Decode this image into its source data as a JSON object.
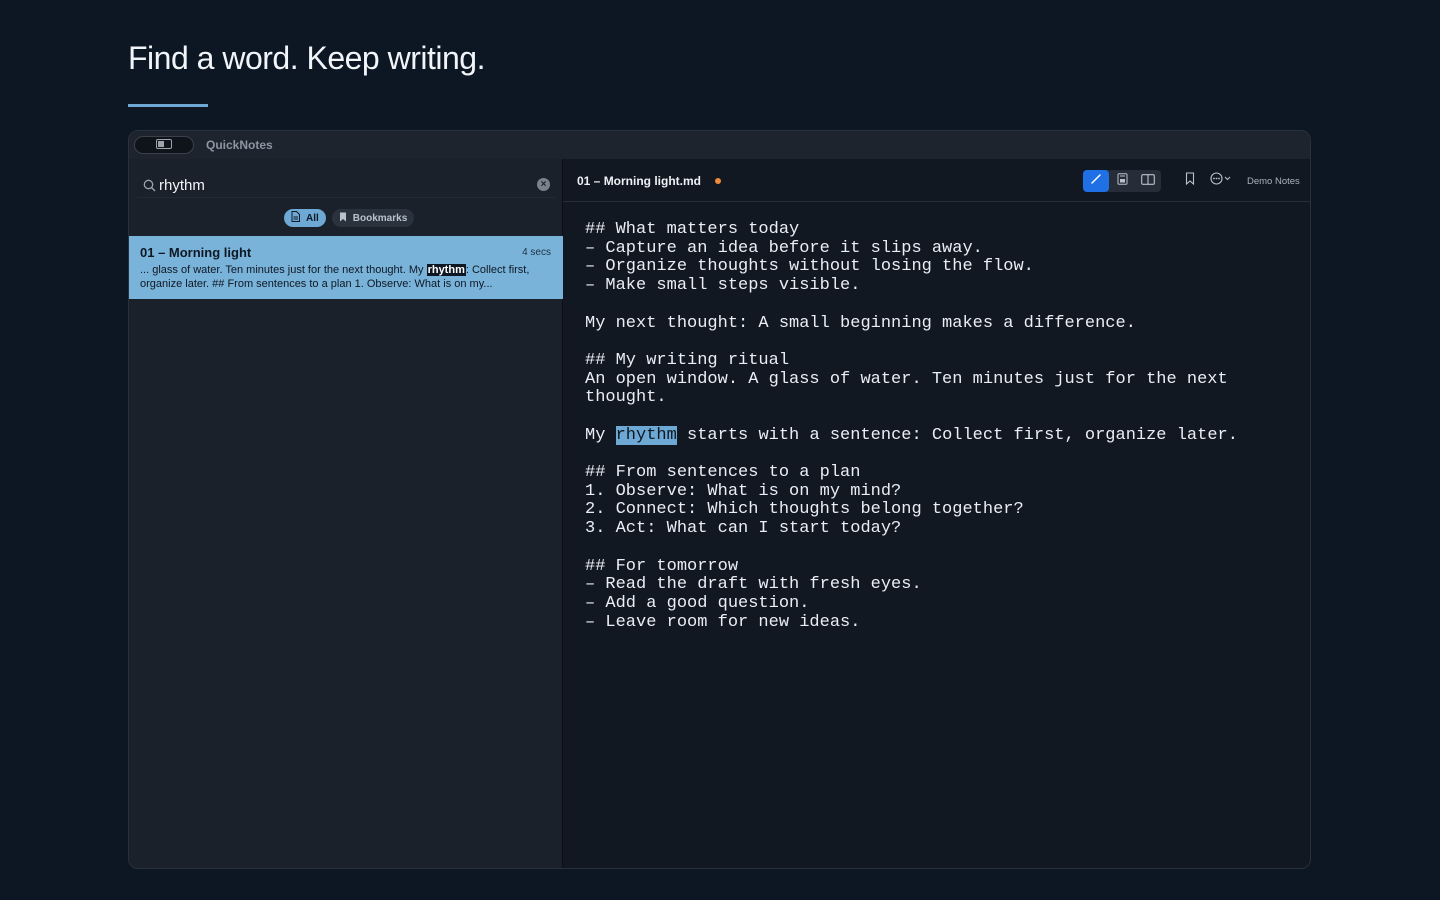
{
  "headline": "Find a word. Keep writing.",
  "app": {
    "name": "QuickNotes"
  },
  "sidebar": {
    "search": {
      "value": "rhythm",
      "placeholder": "Search"
    },
    "filters": [
      {
        "label": "All",
        "icon": "document-icon",
        "active": true
      },
      {
        "label": "Bookmarks",
        "icon": "bookmark-icon",
        "active": false
      }
    ],
    "results": [
      {
        "title": "01 – Morning light",
        "time": "4 secs",
        "snippet_before": "... glass of water. Ten minutes just for the next thought.  My ",
        "snippet_match": "rhythm",
        "snippet_after": ": Collect first, organize later.  ## From sentences to a plan 1. Observe: What is on my..."
      }
    ]
  },
  "editor": {
    "doc_title": "01 – Morning light.md",
    "unsaved": true,
    "workspace": "Demo Notes",
    "toolbar": {
      "modes": [
        "edit-icon",
        "preview-icon",
        "split-view-icon"
      ],
      "active_mode": "edit-icon",
      "tools": [
        "bookmark-icon",
        "more-options-icon"
      ]
    },
    "lines": [
      {
        "text": "## What matters today"
      },
      {
        "text": "– Capture an idea before it slips away."
      },
      {
        "text": "– Organize thoughts without losing the flow."
      },
      {
        "text": "– Make small steps visible."
      },
      {
        "text": ""
      },
      {
        "text": "My next thought: A small beginning makes a difference."
      },
      {
        "text": ""
      },
      {
        "text": "## My writing ritual"
      },
      {
        "text": "An open window. A glass of water. Ten minutes just for the next"
      },
      {
        "text": "thought."
      },
      {
        "text": ""
      },
      {
        "before": "My ",
        "match": "rhythm",
        "after": " starts with a sentence: Collect first, organize later."
      },
      {
        "text": ""
      },
      {
        "text": "## From sentences to a plan"
      },
      {
        "text": "1. Observe: What is on my mind?"
      },
      {
        "text": "2. Connect: Which thoughts belong together?"
      },
      {
        "text": "3. Act: What can I start today?"
      },
      {
        "text": ""
      },
      {
        "text": "## For tomorrow"
      },
      {
        "text": "– Read the draft with fresh eyes."
      },
      {
        "text": "– Add a good question."
      },
      {
        "text": "– Leave room for new ideas."
      }
    ]
  },
  "colors": {
    "accent": "#6ea8d4",
    "active_mode": "#1f6fe5",
    "unsaved_dot": "#f08a3c",
    "selection_card": "#7ab3d9"
  }
}
